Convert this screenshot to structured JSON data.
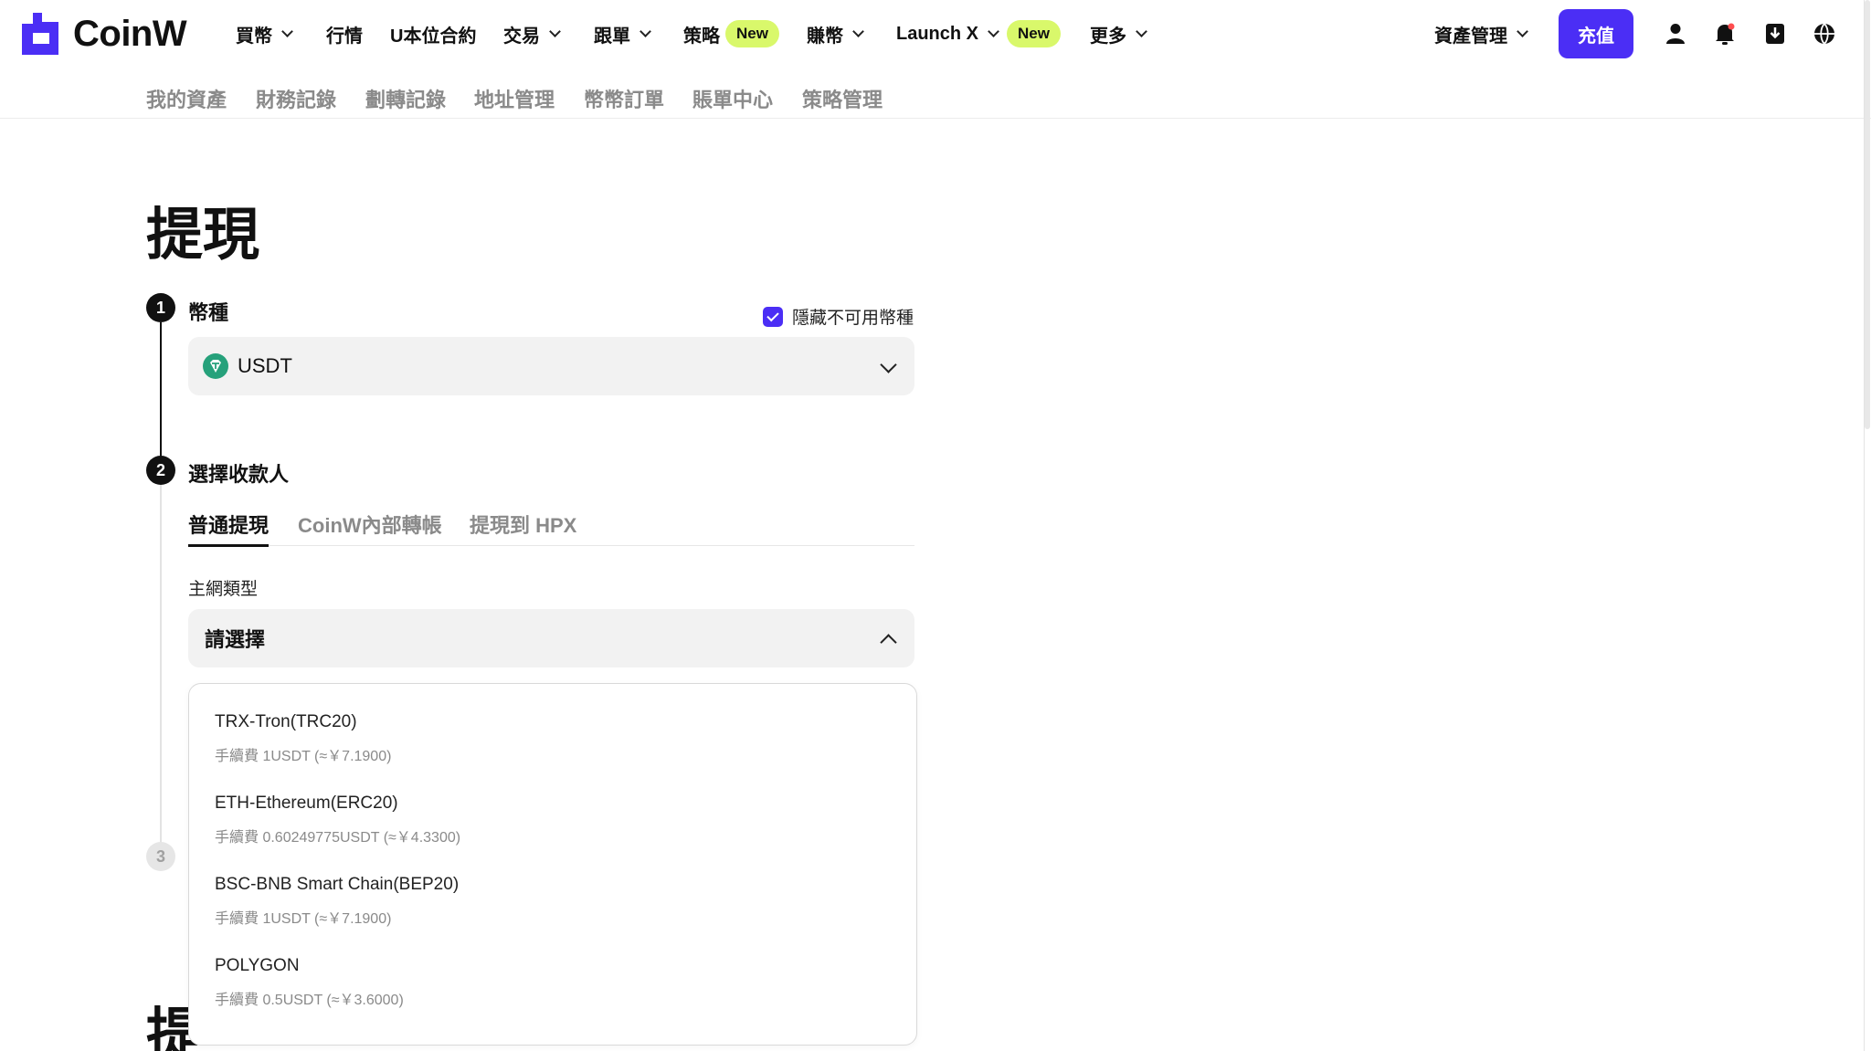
{
  "brand": {
    "name": "CoinW",
    "accent": "#4b2ef5",
    "new_badge_color": "#d9f86b"
  },
  "nav": {
    "items": [
      {
        "label": "買幣"
      },
      {
        "label": "行情"
      },
      {
        "label": "U本位合約"
      },
      {
        "label": "交易"
      },
      {
        "label": "跟單"
      },
      {
        "label": "策略",
        "badge": "New"
      },
      {
        "label": "賺幣"
      },
      {
        "label": "Launch X",
        "badge": "New"
      },
      {
        "label": "更多"
      }
    ],
    "asset_menu": "資產管理",
    "deposit": "充值",
    "icons": [
      "user-icon",
      "bell-icon",
      "download-icon",
      "globe-icon"
    ]
  },
  "subnav": [
    "我的資產",
    "財務記錄",
    "劃轉記錄",
    "地址管理",
    "幣幣訂單",
    "賬單中心",
    "策略管理"
  ],
  "page": {
    "title": "提現",
    "step1": {
      "number": "1",
      "label": "幣種",
      "hide_unavailable": "隱藏不可用幣種",
      "hide_checked": true,
      "coin": "USDT"
    },
    "step2": {
      "number": "2",
      "label": "選擇收款人",
      "tabs": [
        "普通提現",
        "CoinW內部轉帳",
        "提現到 HPX"
      ],
      "active_tab": 0,
      "network_label": "主網類型",
      "network_placeholder": "請選擇",
      "options": [
        {
          "name": "TRX-Tron(TRC20)",
          "fee": "手續費 1USDT (≈￥7.1900)"
        },
        {
          "name": "ETH-Ethereum(ERC20)",
          "fee": "手續費 0.60249775USDT (≈￥4.3300)"
        },
        {
          "name": "BSC-BNB Smart Chain(BEP20)",
          "fee": "手續費 1USDT (≈￥7.1900)"
        },
        {
          "name": "POLYGON",
          "fee": "手續費 0.5USDT (≈￥3.6000)"
        }
      ]
    },
    "step3": {
      "number": "3"
    }
  }
}
